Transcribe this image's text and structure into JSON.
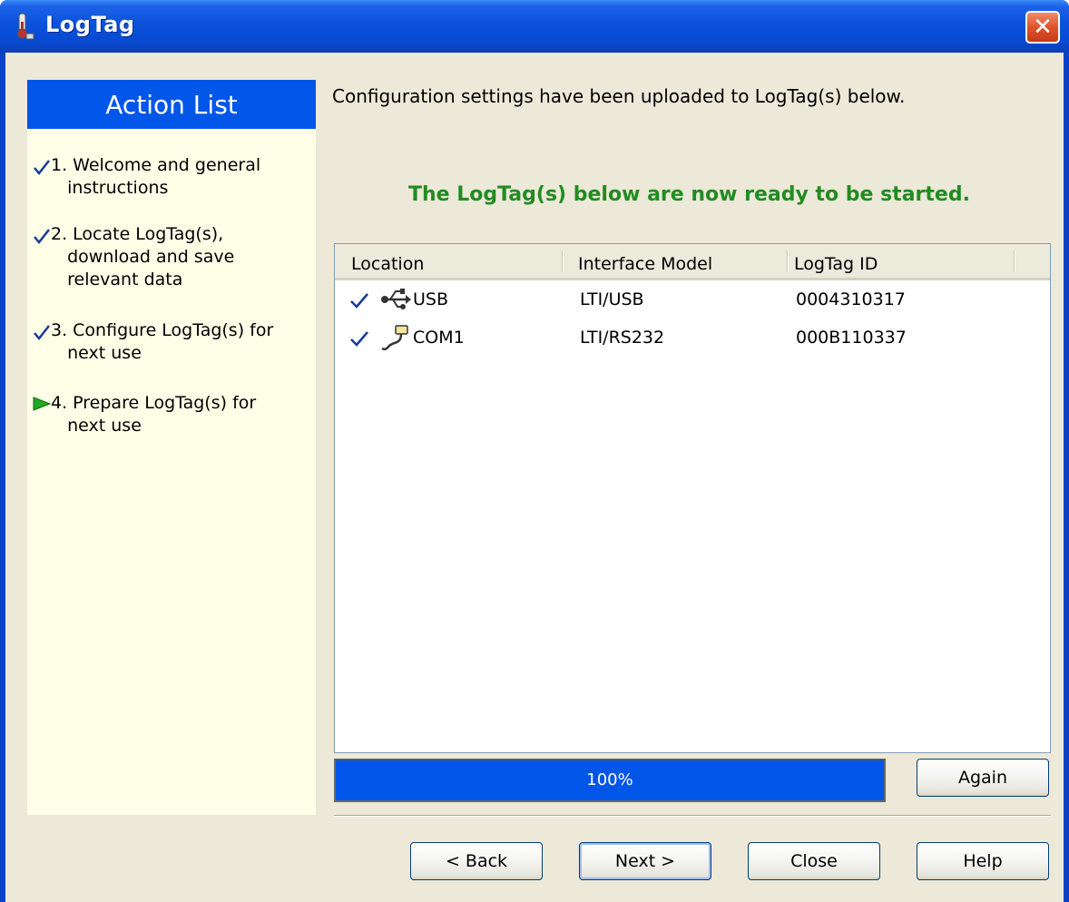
{
  "window": {
    "title": "LogTag"
  },
  "sidebar": {
    "header": "Action List",
    "steps": [
      {
        "label": "1. Welcome and general\n   instructions",
        "state": "done"
      },
      {
        "label": "2. Locate LogTag(s),\n   download and save\n   relevant data",
        "state": "done"
      },
      {
        "label": "3. Configure LogTag(s) for\n   next use",
        "state": "done"
      },
      {
        "label": "4. Prepare LogTag(s) for\n   next use",
        "state": "current"
      }
    ]
  },
  "main": {
    "message": "Configuration settings have been uploaded to LogTag(s) below.",
    "ready_message": "The LogTag(s) below are now ready to be started."
  },
  "table": {
    "columns": [
      "Location",
      "Interface Model",
      "LogTag ID"
    ],
    "rows": [
      {
        "location": "USB",
        "interface": "LTI/USB",
        "id": "0004310317",
        "icon": "usb-icon"
      },
      {
        "location": "COM1",
        "interface": "LTI/RS232",
        "id": "000B110337",
        "icon": "serial-port-icon"
      }
    ]
  },
  "progress": {
    "percent": 100,
    "label": "100%"
  },
  "buttons": {
    "again": "Again",
    "back": "< Back",
    "next": "Next >",
    "close": "Close",
    "help": "Help"
  },
  "colors": {
    "titlebar": "#0a52dc",
    "accent": "#0056e8",
    "ready_text": "#218c21",
    "sidebar_bg": "#ffffe8"
  }
}
